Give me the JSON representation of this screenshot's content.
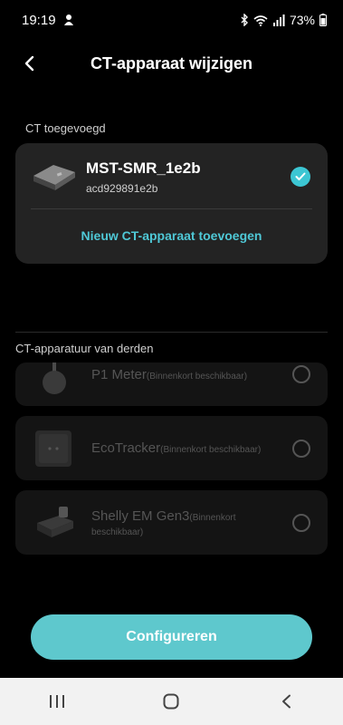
{
  "status_bar": {
    "time": "19:19",
    "battery": "73%"
  },
  "header": {
    "title": "CT-apparaat wijzigen"
  },
  "added_section": {
    "label": "CT toegevoegd",
    "device": {
      "name": "MST-SMR_1e2b",
      "id": "acd929891e2b",
      "selected": true
    },
    "add_link": "Nieuw CT-apparaat toevoegen"
  },
  "third_party": {
    "label": "CT-apparatuur van derden",
    "items": [
      {
        "name": "P1 Meter",
        "note": "(Binnenkort beschikbaar)"
      },
      {
        "name": "EcoTracker",
        "note": "(Binnenkort beschikbaar)"
      },
      {
        "name": "Shelly EM Gen3",
        "note": "(Binnenkort beschikbaar)"
      }
    ]
  },
  "cta": {
    "label": "Configureren"
  },
  "colors": {
    "accent": "#3cc6d3",
    "button": "#5ec8cd",
    "card": "#232323"
  }
}
